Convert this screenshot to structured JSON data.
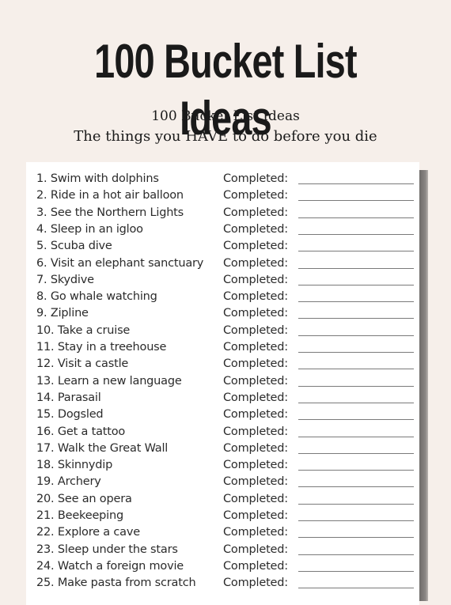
{
  "header": {
    "title": "100 Bucket List Ideas",
    "subtitle_line1": "100 Bucket List Ideas",
    "subtitle_line2": "The things you HAVE to do before you die"
  },
  "list": {
    "completed_label": "Completed:",
    "items": [
      "1. Swim with dolphins",
      "2. Ride in a hot air balloon",
      "3. See the Northern Lights",
      "4. Sleep in an igloo",
      "5. Scuba dive",
      "6. Visit an elephant sanctuary",
      "7. Skydive",
      "8. Go whale watching",
      "9. Zipline",
      "10. Take a cruise",
      "11. Stay in a treehouse",
      "12. Visit a castle",
      "13. Learn a new language",
      "14. Parasail",
      "15. Dogsled",
      "16. Get a tattoo",
      "17. Walk the Great Wall",
      "18. Skinnydip",
      "19. Archery",
      "20. See an opera",
      "21. Beekeeping",
      "22. Explore a cave",
      "23. Sleep under the stars",
      "24. Watch a foreign movie",
      "25. Make pasta from scratch"
    ]
  }
}
